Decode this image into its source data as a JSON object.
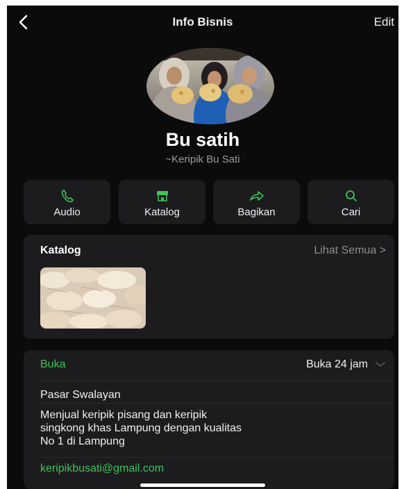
{
  "header": {
    "back_icon": "chevron-left-icon",
    "title": "Info Bisnis",
    "edit_label": "Edit"
  },
  "profile": {
    "name": "Bu satih",
    "subtitle": "~Keripik Bu Sati"
  },
  "actions": [
    {
      "icon": "phone-icon",
      "label": "Audio"
    },
    {
      "icon": "storefront-icon",
      "label": "Katalog"
    },
    {
      "icon": "share-arrow-icon",
      "label": "Bagikan"
    },
    {
      "icon": "search-icon",
      "label": "Cari"
    }
  ],
  "catalog": {
    "title": "Katalog",
    "see_all": "Lihat Semua >"
  },
  "hours": {
    "status": "Buka",
    "value": "Buka 24 jam"
  },
  "business": {
    "category": "Pasar Swalayan",
    "description_lines": [
      "Menjual keripik pisang dan keripik",
      "singkong khas Lampung dengan kualitas",
      "No 1 di Lampung"
    ],
    "email": "keripikbusati@gmail.com"
  },
  "colors": {
    "background": "#0b0b0b",
    "card": "#1c1c1e",
    "accent_green": "#3fc35a",
    "muted": "#8e8e93"
  }
}
